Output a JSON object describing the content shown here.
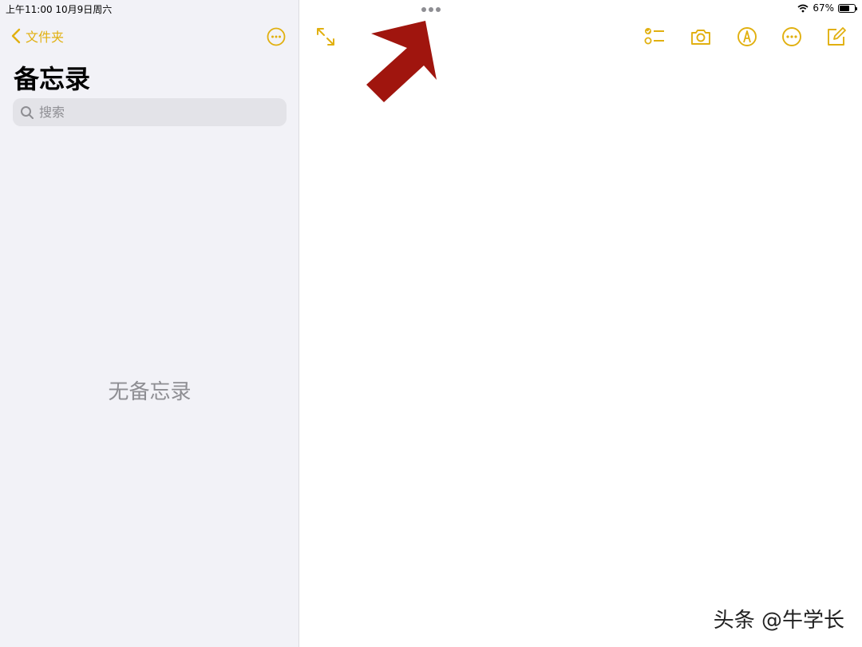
{
  "status_bar": {
    "time_date": "上午11:00   10月9日周六",
    "battery_percent": "67%",
    "battery_level": 0.67
  },
  "sidebar": {
    "back_label": "文件夹",
    "title": "备忘录",
    "search_placeholder": "搜索",
    "empty_text": "无备忘录"
  },
  "toolbar": {
    "icons": [
      "expand-icon",
      "checklist-icon",
      "camera-icon",
      "markup-pen-icon",
      "more-icon",
      "compose-icon"
    ]
  },
  "watermark": "头条 @牛学长",
  "colors": {
    "accent": "#e1b010",
    "sidebar_bg": "#f2f2f7",
    "annotation_arrow": "#a0150e"
  }
}
